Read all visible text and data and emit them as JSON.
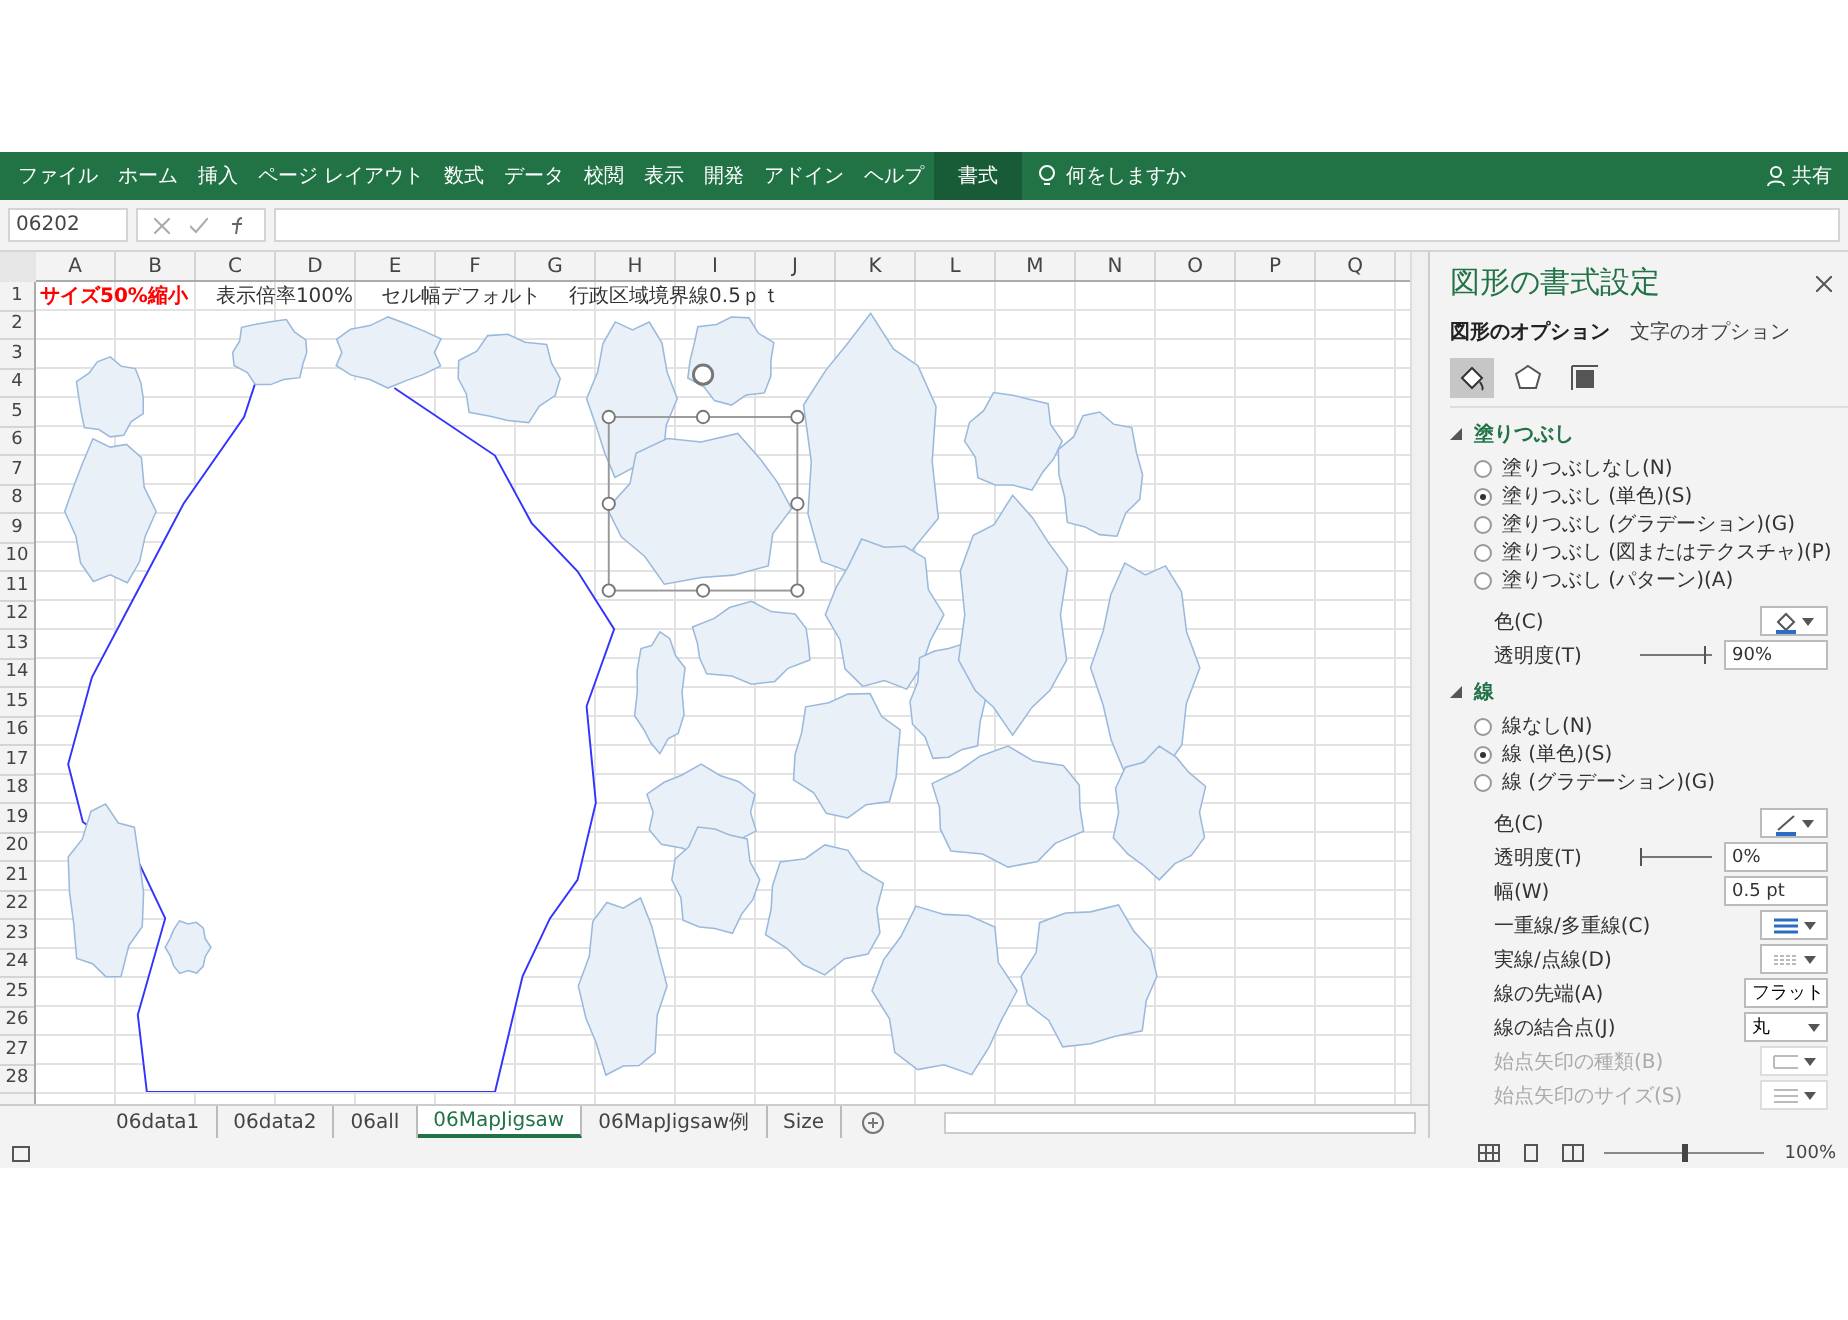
{
  "ribbon": {
    "tabs": [
      {
        "label": "ファイル",
        "selected": false
      },
      {
        "label": "ホーム",
        "selected": false
      },
      {
        "label": "挿入",
        "selected": false
      },
      {
        "label": "ページ レイアウト",
        "selected": false
      },
      {
        "label": "数式",
        "selected": false
      },
      {
        "label": "データ",
        "selected": false
      },
      {
        "label": "校閲",
        "selected": false
      },
      {
        "label": "表示",
        "selected": false
      },
      {
        "label": "開発",
        "selected": false
      },
      {
        "label": "アドイン",
        "selected": false
      },
      {
        "label": "ヘルプ",
        "selected": false
      },
      {
        "label": "書式",
        "selected": true
      }
    ],
    "tell_me": "何をしますか",
    "share": "共有"
  },
  "formula_bar": {
    "name_box": "06202"
  },
  "sheet": {
    "columns": [
      "A",
      "B",
      "C",
      "D",
      "E",
      "F",
      "G",
      "H",
      "I",
      "J",
      "K",
      "L",
      "M",
      "N",
      "O",
      "P",
      "Q"
    ],
    "rows": [
      "1",
      "2",
      "3",
      "4",
      "5",
      "6",
      "7",
      "8",
      "9",
      "10",
      "11",
      "12",
      "13",
      "14",
      "15",
      "16",
      "17",
      "18",
      "19",
      "20",
      "21",
      "22",
      "23",
      "24",
      "25",
      "26",
      "27",
      "28"
    ],
    "row1_texts": [
      {
        "text": "サイズ50%縮小",
        "kind": "emphasis"
      },
      {
        "text": "表示倍率100%",
        "kind": "plain"
      },
      {
        "text": "セル幅デフォルト",
        "kind": "plain"
      },
      {
        "text": "行政区域境界線0.5ｐｔ",
        "kind": "plain"
      }
    ]
  },
  "sheet_tabs": [
    {
      "label": "06data1",
      "selected": false
    },
    {
      "label": "06data2",
      "selected": false
    },
    {
      "label": "06all",
      "selected": false
    },
    {
      "label": "06MapJigsaw",
      "selected": true
    },
    {
      "label": "06MapJigsaw例",
      "selected": false
    },
    {
      "label": "Size",
      "selected": false
    }
  ],
  "status_bar": {
    "zoom": "100%",
    "zoom_level": {
      "level": 0.5
    }
  },
  "pane": {
    "title": "図形の書式設定",
    "tabs": [
      {
        "label": "図形のオプション",
        "selected": true
      },
      {
        "label": "文字のオプション",
        "selected": false
      }
    ],
    "icon_tabs": [
      {
        "kind": "fill",
        "selected": true
      },
      {
        "kind": "effects",
        "selected": false
      },
      {
        "kind": "size",
        "selected": false
      }
    ],
    "sections": [
      {
        "title": "塗りつぶし",
        "expanded": true,
        "options": [
          {
            "label": "塗りつぶしなし(N)",
            "selected": false
          },
          {
            "label": "塗りつぶし (単色)(S)",
            "selected": true
          },
          {
            "label": "塗りつぶし (グラデーション)(G)",
            "selected": false
          },
          {
            "label": "塗りつぶし (図またはテクスチャ)(P)",
            "selected": false
          },
          {
            "label": "塗りつぶし (パターン)(A)",
            "selected": false
          }
        ],
        "properties": [
          {
            "kind": "fill_color",
            "label": "色(C)",
            "disabled": false
          },
          {
            "kind": "slider",
            "label": "透明度(T)",
            "level": 0.9,
            "value": "90%",
            "disabled": false
          }
        ]
      },
      {
        "title": "線",
        "expanded": true,
        "options": [
          {
            "label": "線なし(N)",
            "selected": false
          },
          {
            "label": "線 (単色)(S)",
            "selected": true
          },
          {
            "label": "線 (グラデーション)(G)",
            "selected": false
          }
        ],
        "properties": [
          {
            "kind": "line_color",
            "label": "色(C)",
            "disabled": false
          },
          {
            "kind": "slider",
            "label": "透明度(T)",
            "level": 0,
            "value": "0%",
            "disabled": false
          },
          {
            "kind": "spin",
            "label": "幅(W)",
            "value": "0.5 pt",
            "disabled": false
          },
          {
            "kind": "compound",
            "label": "一重線/多重線(C)",
            "disabled": false
          },
          {
            "kind": "dash",
            "label": "実線/点線(D)",
            "disabled": false
          },
          {
            "kind": "select",
            "label": "線の先端(A)",
            "value": "フラット",
            "disabled": false
          },
          {
            "kind": "select",
            "label": "線の結合点(J)",
            "value": "丸",
            "disabled": false
          },
          {
            "kind": "arrow_type",
            "label": "始点矢印の種類(B)",
            "disabled": true
          },
          {
            "kind": "arrow_size",
            "label": "始点矢印のサイズ(S)",
            "disabled": true
          }
        ]
      }
    ]
  }
}
